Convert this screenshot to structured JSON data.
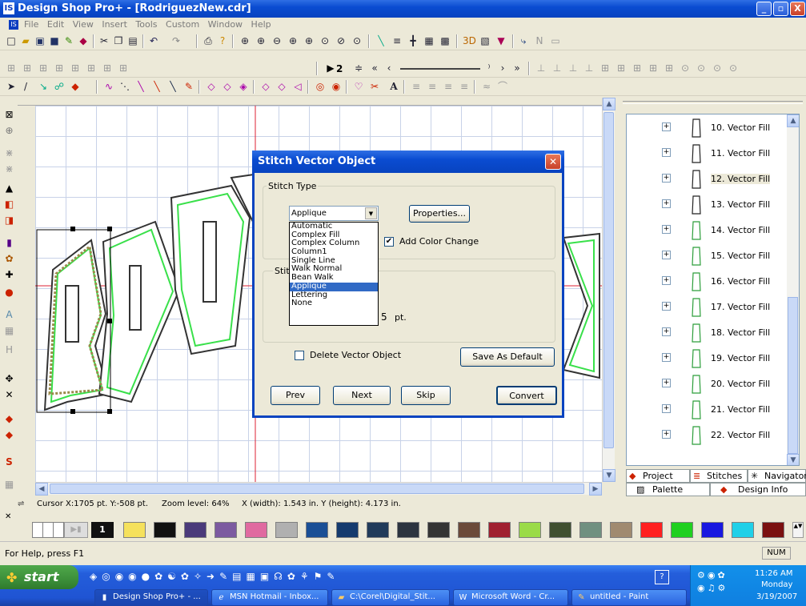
{
  "window": {
    "title": "Design Shop Pro+ - [RodriguezNew.cdr]",
    "logo": "IS",
    "min": "_",
    "max": "▫",
    "close": "X"
  },
  "menu": [
    "File",
    "Edit",
    "View",
    "Insert",
    "Tools",
    "Custom",
    "Window",
    "Help"
  ],
  "toolbar2": {
    "step_value": "2"
  },
  "status": {
    "cursor": "Cursor X:1705 pt. Y:-508 pt.",
    "zoom": "Zoom level: 64%",
    "size": "X (width): 1.543 in.  Y (height): 4.173 in."
  },
  "palette": {
    "number": "1",
    "colors": [
      "#ffffff",
      "#ffffff",
      "#ffffff",
      "#f5e15c",
      "#111111",
      "#4a3a7a",
      "#7c5aa0",
      "#e06aa0",
      "#b0b0b0",
      "#1a4f96",
      "#143a6e",
      "#203a5a",
      "#2c3440",
      "#343434",
      "#6b4a3a",
      "#a02030",
      "#9adb48",
      "#405030",
      "#709080",
      "#a08a70",
      "#ff2020",
      "#20d020",
      "#1818e0",
      "#20d0e8",
      "#7a1010"
    ]
  },
  "help": {
    "text": "For Help, press F1",
    "num": "NUM"
  },
  "taskbar": {
    "start": "start",
    "buttons": [
      "Design Shop Pro+ - ...",
      "MSN Hotmail - Inbox...",
      "C:\\Corel\\Digital_Stit...",
      "Microsoft Word - Cr...",
      "untitled - Paint"
    ],
    "time": "11:26 AM",
    "day": "Monday",
    "date": "3/19/2007"
  },
  "panel": {
    "items": [
      "10. Vector Fill",
      "11. Vector Fill",
      "12. Vector Fill",
      "13. Vector Fill",
      "14. Vector Fill",
      "15. Vector Fill",
      "16. Vector Fill",
      "17. Vector Fill",
      "18. Vector Fill",
      "19. Vector Fill",
      "20. Vector Fill",
      "21. Vector Fill",
      "22. Vector Fill"
    ],
    "tabs": {
      "project": "Project",
      "stitches": "Stitches",
      "navigator": "Navigator",
      "palette": "Palette",
      "design_info": "Design Info"
    }
  },
  "dialog": {
    "title": "Stitch Vector Object",
    "stitch_type_label": "Stitch Type",
    "selected": "Applique",
    "options": [
      "Automatic",
      "Complex Fill",
      "Complex Column",
      "Column1",
      "Single Line",
      "Walk Normal",
      "Bean Walk",
      "Applique",
      "Lettering",
      "None"
    ],
    "properties": "Properties...",
    "add_color_change": "Add Color Change",
    "stitch_group_label": "Stitc",
    "width_suffix": "5",
    "unit": "pt.",
    "delete_vector": "Delete Vector Object",
    "save_default": "Save As Default",
    "prev": "Prev",
    "next": "Next",
    "skip": "Skip",
    "convert": "Convert"
  }
}
